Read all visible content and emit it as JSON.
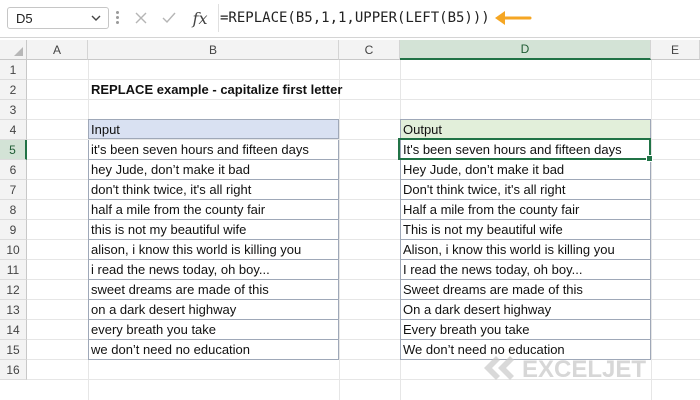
{
  "formula_bar": {
    "name_box": "D5",
    "formula": "=REPLACE(B5,1,1,UPPER(LEFT(B5)))",
    "fx_label": "fx",
    "arrow_color": "#f5a623"
  },
  "columns": [
    "A",
    "B",
    "C",
    "D",
    "E"
  ],
  "selected_column": "D",
  "rows": [
    "1",
    "2",
    "3",
    "4",
    "5",
    "6",
    "7",
    "8",
    "9",
    "10",
    "11",
    "12",
    "13",
    "14",
    "15",
    "16"
  ],
  "selected_row": "5",
  "sheet": {
    "title": "REPLACE example - capitalize first letter",
    "input_header": "Input",
    "output_header": "Output",
    "input_header_color": "#d9e1f2",
    "output_header_color": "#e2efda",
    "inputs": [
      "it's been seven hours and fifteen days",
      "hey Jude, don’t make it bad",
      "don't think twice, it's all right",
      "half a mile from the county fair",
      "this is not my beautiful wife",
      "alison, i know this world is killing you",
      "i read the news today, oh boy...",
      "sweet dreams are made of this",
      "on a dark desert highway",
      "every breath you take",
      "we don’t need no education"
    ],
    "outputs": [
      "It's been seven hours and fifteen days",
      "Hey Jude, don’t make it bad",
      "Don't think twice, it's all right",
      "Half a mile from the county fair",
      "This is not my beautiful wife",
      "Alison, i know this world is killing you",
      "I read the news today, oh boy...",
      "Sweet dreams are made of this",
      "On a dark desert highway",
      "Every breath you take",
      "We don’t need no education"
    ]
  },
  "watermark": {
    "text": "EXCELJET"
  }
}
